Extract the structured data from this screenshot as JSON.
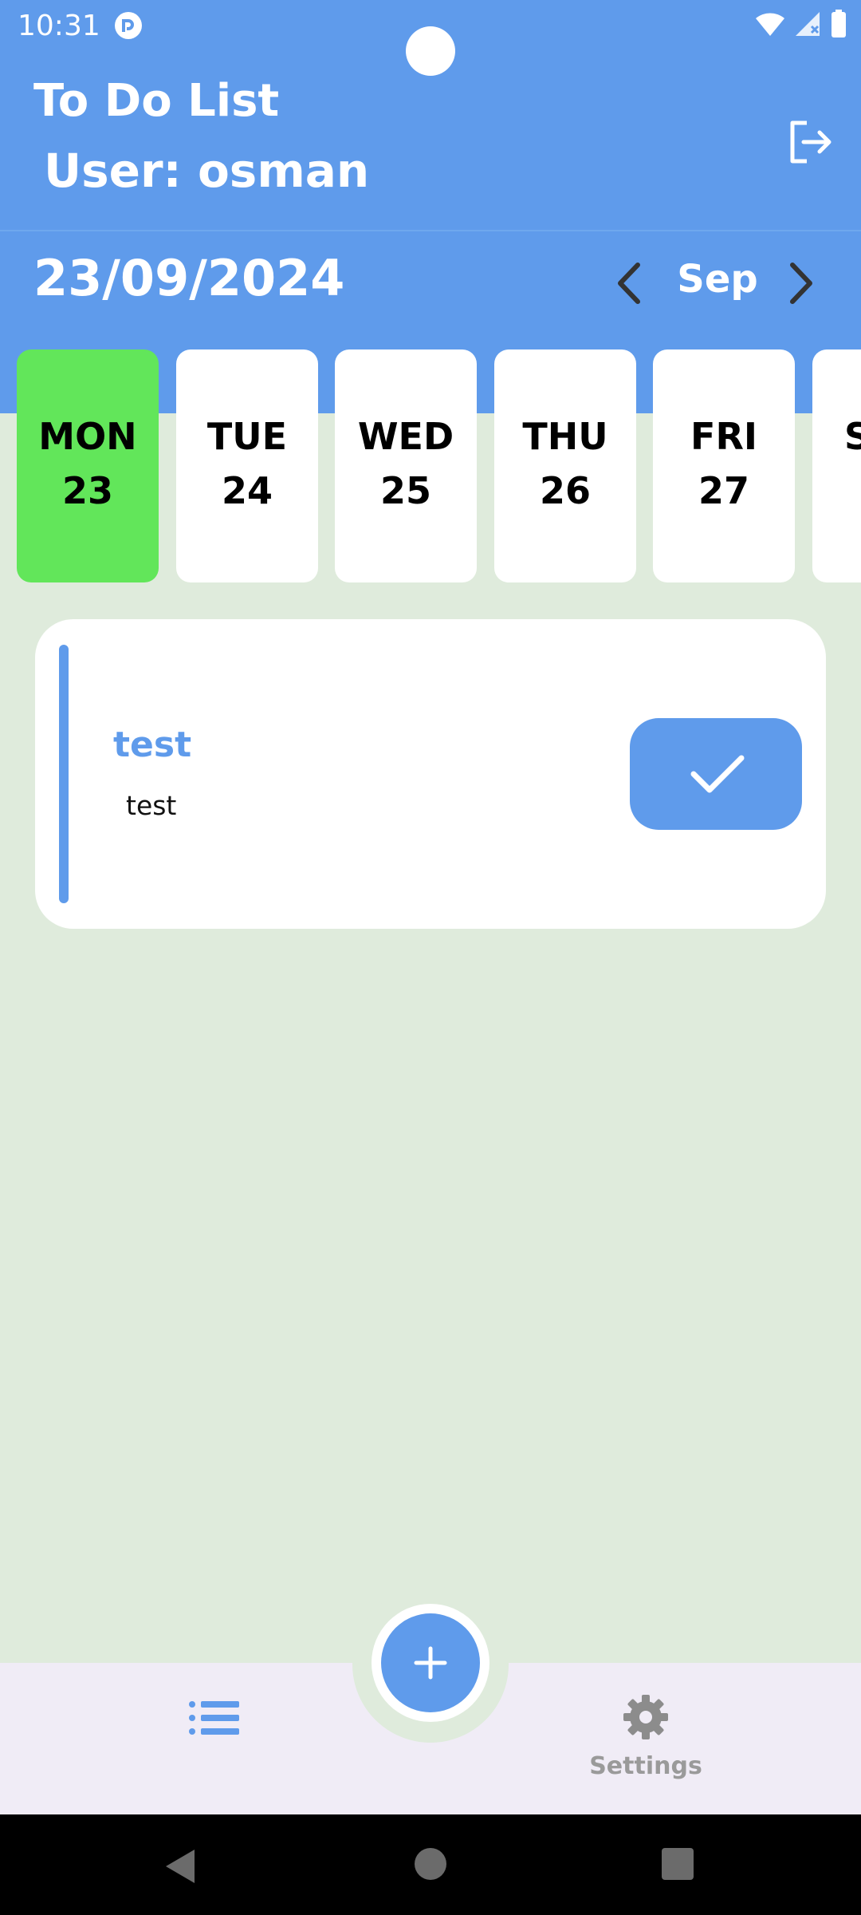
{
  "status_bar": {
    "time": "10:31"
  },
  "header": {
    "title": "To Do List",
    "user_label": "User: osman",
    "date": "23/09/2024",
    "month": "Sep"
  },
  "days": [
    {
      "name": "MON",
      "num": "23",
      "selected": true
    },
    {
      "name": "TUE",
      "num": "24",
      "selected": false
    },
    {
      "name": "WED",
      "num": "25",
      "selected": false
    },
    {
      "name": "THU",
      "num": "26",
      "selected": false
    },
    {
      "name": "FRI",
      "num": "27",
      "selected": false
    },
    {
      "name": "S",
      "num": "",
      "selected": false
    }
  ],
  "tasks": [
    {
      "title": "test",
      "description": "test"
    }
  ],
  "bottom_nav": {
    "settings_label": "Settings"
  },
  "colors": {
    "primary": "#5F9BEB",
    "selected_day": "#62E65A",
    "background": "#DFEBDC",
    "nav_background": "#F0ECF6"
  },
  "icons": {
    "logout": "logout-icon",
    "prev": "chevron-left-icon",
    "next": "chevron-right-icon",
    "complete": "check-icon",
    "add": "plus-icon",
    "list": "list-icon",
    "settings": "gear-icon"
  }
}
